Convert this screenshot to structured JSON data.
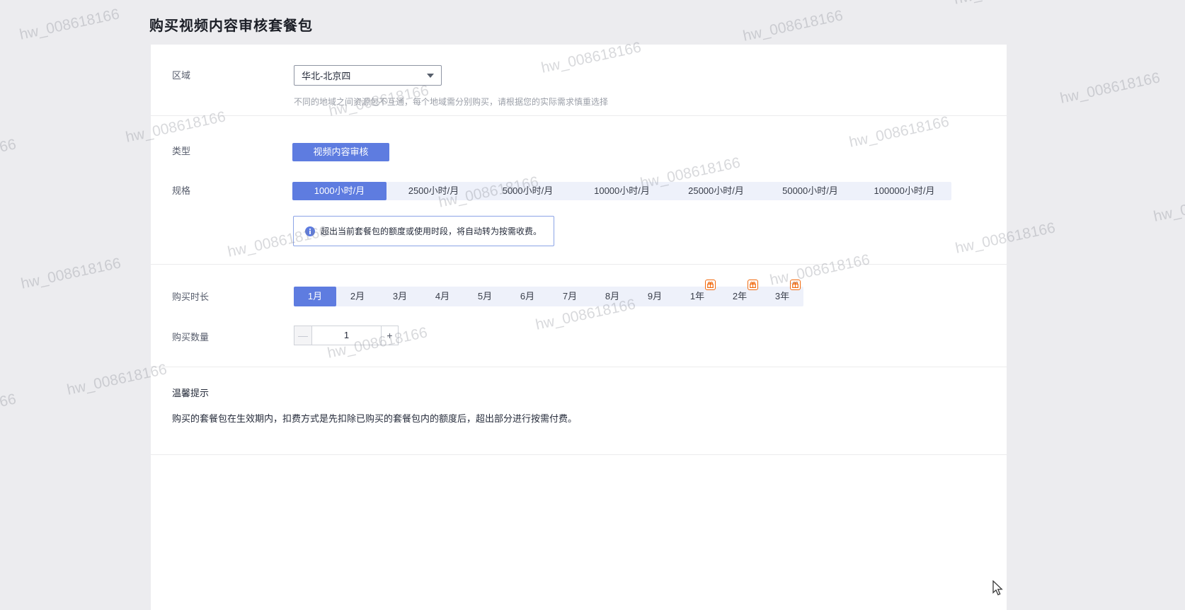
{
  "page": {
    "title": "购买视频内容审核套餐包",
    "watermark": "hw_008618166"
  },
  "form": {
    "region": {
      "label": "区域",
      "value": "华北-北京四",
      "hint": "不同的地域之间资源包不互通，每个地域需分别购买，请根据您的实际需求慎重选择"
    },
    "type": {
      "label": "类型",
      "selected": "视频内容审核"
    },
    "spec": {
      "label": "规格",
      "selected_index": 0,
      "options": [
        "1000小时/月",
        "2500小时/月",
        "5000小时/月",
        "10000小时/月",
        "25000小时/月",
        "50000小时/月",
        "100000小时/月"
      ],
      "notice": "超出当前套餐包的额度或使用时段，将自动转为按需收费。"
    },
    "duration": {
      "label": "购买时长",
      "selected_index": 0,
      "options": [
        {
          "label": "1月",
          "gift": false
        },
        {
          "label": "2月",
          "gift": false
        },
        {
          "label": "3月",
          "gift": false
        },
        {
          "label": "4月",
          "gift": false
        },
        {
          "label": "5月",
          "gift": false
        },
        {
          "label": "6月",
          "gift": false
        },
        {
          "label": "7月",
          "gift": false
        },
        {
          "label": "8月",
          "gift": false
        },
        {
          "label": "9月",
          "gift": false
        },
        {
          "label": "1年",
          "gift": true
        },
        {
          "label": "2年",
          "gift": true
        },
        {
          "label": "3年",
          "gift": true
        }
      ]
    },
    "quantity": {
      "label": "购买数量",
      "value": "1",
      "decrease": "—",
      "increase": "+"
    }
  },
  "tips": {
    "title": "温馨提示",
    "body": "购买的套餐包在生效期内，扣费方式是先扣除已购买的套餐包内的额度后，超出部分进行按需付费。"
  },
  "colors": {
    "accent_blue": "#5e7ce0",
    "option_bg": "#eef1fa",
    "gift_orange": "#f2690d",
    "page_bg": "#ececef",
    "card_bg": "#ffffff"
  }
}
